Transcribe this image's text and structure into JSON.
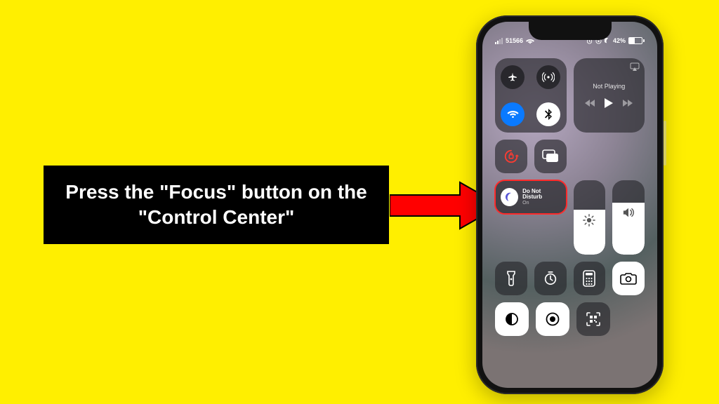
{
  "instruction": "Press the \"Focus\" button on the \"Control Center\"",
  "status": {
    "carrier": "51566",
    "wifi": true,
    "battery_percent": "42%",
    "dnd_icon": true,
    "alarm_icon": true,
    "lock_orientation_icon": true
  },
  "media": {
    "label": "Not Playing"
  },
  "focus": {
    "title": "Do Not Disturb",
    "subtitle": "On"
  },
  "sliders": {
    "brightness_percent": 60,
    "volume_percent": 70
  },
  "tiles": {
    "row1": [
      "orientation-lock",
      "screen-mirroring"
    ],
    "row3": [
      "flashlight",
      "timer",
      "calculator",
      "camera"
    ],
    "row4": [
      "dark-mode",
      "screen-record",
      "qr-scanner"
    ]
  }
}
